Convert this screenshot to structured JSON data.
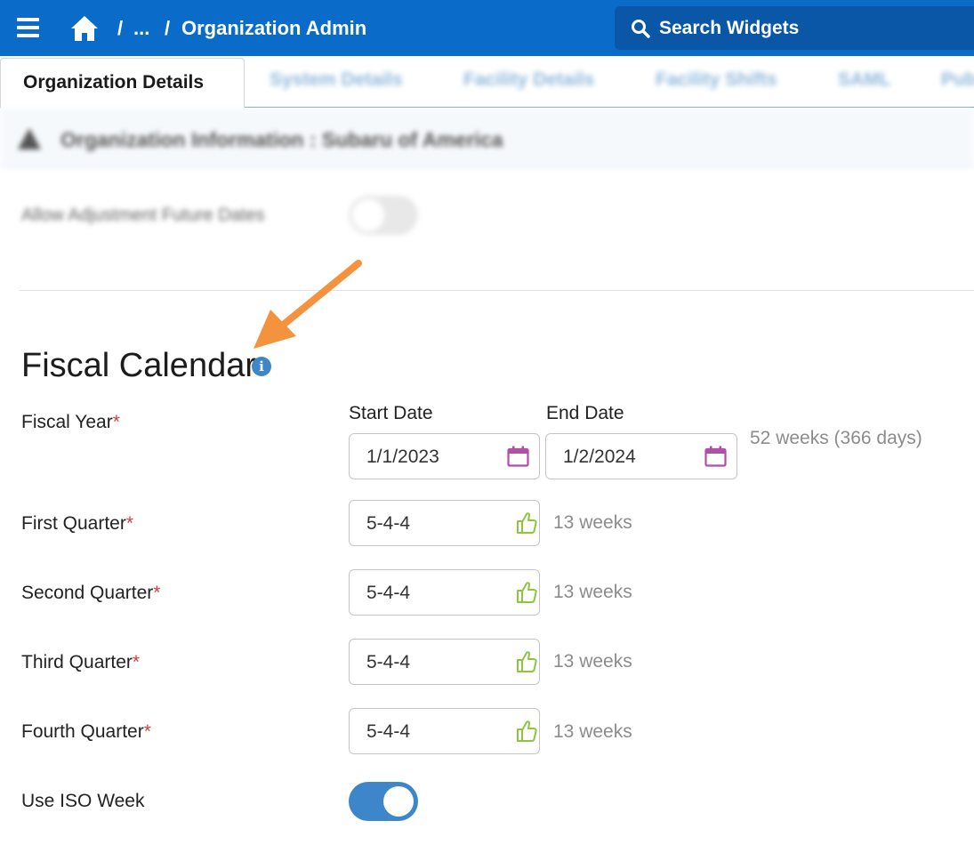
{
  "header": {
    "breadcrumb_sep1": "/",
    "breadcrumb_ellipsis": "...",
    "breadcrumb_sep2": "/",
    "breadcrumb_current": "Organization Admin",
    "search_label": "Search Widgets"
  },
  "tabs": {
    "active": "Organization Details",
    "others": [
      "System Details",
      "Facility Details",
      "Facility Shifts",
      "SAML",
      "Pub"
    ]
  },
  "section": {
    "title": "Organization Information : Subaru of America",
    "blurred_setting_label": "Allow Adjustment Future Dates"
  },
  "fiscal_calendar": {
    "title": "Fiscal Calendar",
    "info_glyph": "i",
    "required_marker": "*",
    "fiscal_year": {
      "label": "Fiscal Year",
      "start_label": "Start Date",
      "end_label": "End Date",
      "start_value": "1/1/2023",
      "end_value": "1/2/2024",
      "duration": "52 weeks (366 days)"
    },
    "quarters": [
      {
        "label": "First Quarter",
        "pattern": "5-4-4",
        "weeks": "13 weeks"
      },
      {
        "label": "Second Quarter",
        "pattern": "5-4-4",
        "weeks": "13 weeks"
      },
      {
        "label": "Third Quarter",
        "pattern": "5-4-4",
        "weeks": "13 weeks"
      },
      {
        "label": "Fourth Quarter",
        "pattern": "5-4-4",
        "weeks": "13 weeks"
      }
    ],
    "iso_week": {
      "label": "Use ISO Week",
      "enabled": true
    }
  },
  "colors": {
    "topbar": "#0a6cc8",
    "search_bg": "#0957a6",
    "accent_blue": "#3d86c9",
    "calendar_icon": "#b04fa5",
    "thumb_icon": "#8cc63f",
    "arrow": "#f5923e",
    "required": "#d83a3a"
  },
  "icons": [
    "hamburger-menu-icon",
    "home-icon",
    "search-icon",
    "warning-icon",
    "info-icon",
    "calendar-icon",
    "thumbs-up-icon",
    "annotation-arrow"
  ]
}
